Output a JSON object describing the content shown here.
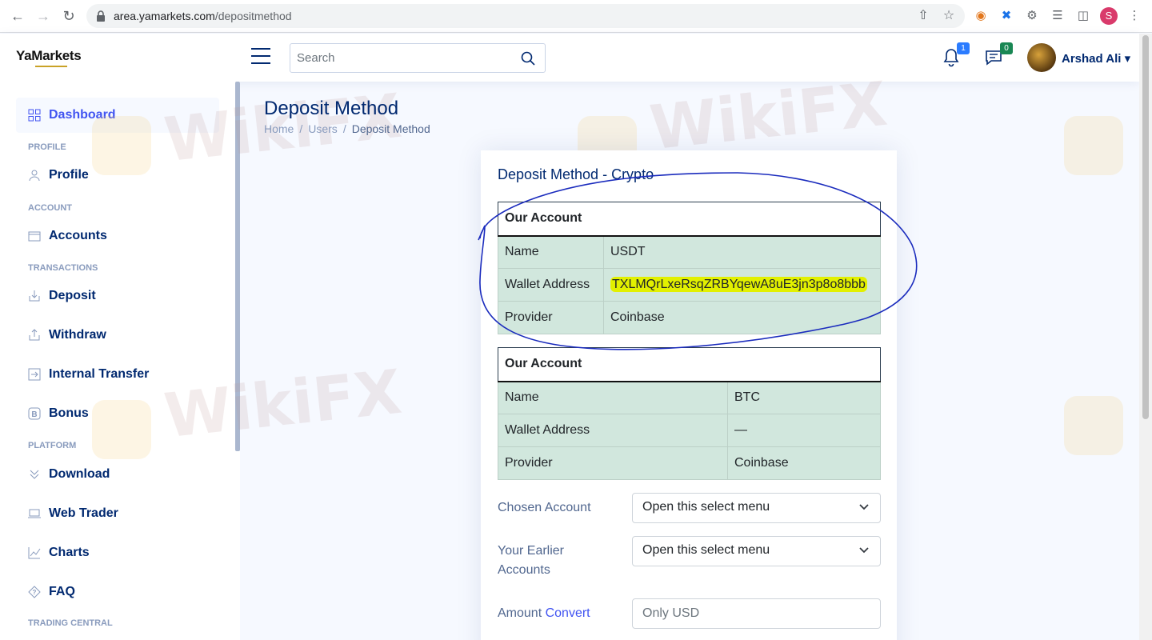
{
  "browser": {
    "url_domain": "area.yamarkets.com",
    "url_path": "/depositmethod",
    "profile_initial": "S"
  },
  "header": {
    "logo_text": "YaMarkets",
    "search_placeholder": "Search",
    "notifications_count": "1",
    "messages_count": "0",
    "user_name": "Arshad Ali"
  },
  "sidebar": {
    "dashboard": "Dashboard",
    "sections": {
      "profile": "PROFILE",
      "account": "ACCOUNT",
      "transactions": "TRANSACTIONS",
      "platform": "PLATFORM",
      "trading_central": "TRADING CENTRAL"
    },
    "items": {
      "profile": "Profile",
      "accounts": "Accounts",
      "deposit": "Deposit",
      "withdraw": "Withdraw",
      "internal_transfer": "Internal Transfer",
      "bonus": "Bonus",
      "download": "Download",
      "web_trader": "Web Trader",
      "charts": "Charts",
      "faq": "FAQ"
    }
  },
  "watermark": "WikiFX",
  "page": {
    "title": "Deposit Method",
    "breadcrumb": [
      "Home",
      "Users",
      "Deposit Method"
    ]
  },
  "card": {
    "title": "Deposit Method - Crypto",
    "tables": [
      {
        "header": "Our Account",
        "rows": [
          {
            "label": "Name",
            "value": "USDT"
          },
          {
            "label": "Wallet Address",
            "value": "TXLMQrLxeRsqZRBYqewA8uE3jn3p8o8bbb"
          },
          {
            "label": "Provider",
            "value": "Coinbase"
          }
        ]
      },
      {
        "header": "Our Account",
        "rows": [
          {
            "label": "Name",
            "value": "BTC"
          },
          {
            "label": "Wallet Address",
            "value": "—"
          },
          {
            "label": "Provider",
            "value": "Coinbase"
          }
        ]
      }
    ],
    "form": {
      "chosen_account_label": "Chosen Account",
      "chosen_account_value": "Open this select menu",
      "earlier_accounts_label_1": "Your Earlier",
      "earlier_accounts_label_2": "Accounts",
      "earlier_accounts_value": "Open this select menu",
      "amount_label": "Amount",
      "convert_link": "Convert",
      "amount_placeholder": "Only USD"
    }
  },
  "colors": {
    "primary": "#4154f1",
    "heading": "#012970",
    "table_success": "#d1e7dd",
    "highlight": "#e2f000",
    "annotation": "#1a2bbd"
  }
}
